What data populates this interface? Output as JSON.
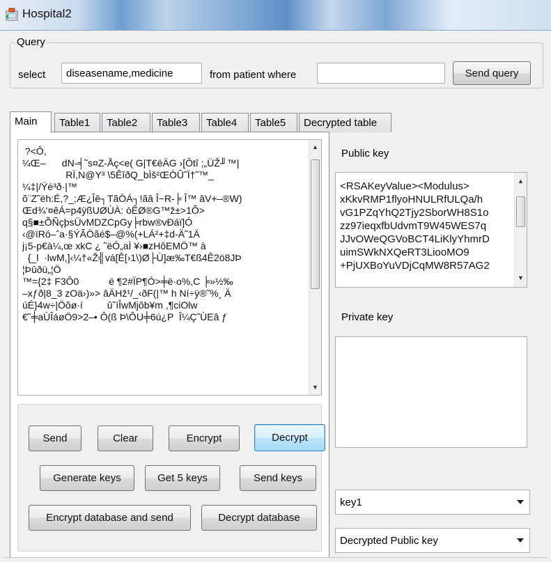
{
  "window": {
    "title": "Hospital2"
  },
  "query": {
    "group_label": "Query",
    "select_label": "select",
    "select_value": "diseasename,medicine",
    "from_label": "from patient where",
    "where_value": "",
    "send_label": "Send query"
  },
  "tabs": [
    {
      "label": "Main",
      "active": true
    },
    {
      "label": "Table1"
    },
    {
      "label": "Table2"
    },
    {
      "label": "Table3"
    },
    {
      "label": "Table4"
    },
    {
      "label": "Table5"
    },
    {
      "label": "Decrypted table"
    }
  ],
  "main": {
    "cipher_text": " ?<Ô,\n¼Œ–      dN-╡˜s¤Z-Åç<e( G|T€ëÄG ›[Ôtî ;„ÜŽ╜™|\n                RÏ,N@Y³ \\5ÊîðQ_bÌš²ŒÒÛ˜Ï†˜™_\n¼‡|/Ýé³ð·|™\nõ¨Z˜ëh:É,?_;Æ¿Îê┐TãÓÁ┐!ãâ Î−R-╞ Î™ âV+–®W)\nŒd¾‘¤êÁ=p4ÿßUØÙÀ: òÊØ®G™ž±>1Õ>\nq§■±ÕÑçþsÜvMDZCpGy╞rbw®vÐáï]Ó\n‹@ïRó–ˆa·§ÝÃÖãé$–@%(+LÁ²+‡d-Ä˜1Ä\nj¡5-p€à¼,œ xkC ¿ ˜ëÓ„aÌ ¥›■zHôEMÖ™ à\n  {_l  ·lwM,]‹¼†«Ž╣và[Ê[›1\\)Ø├Ù]æ‰T€ß4Ê2ö8JÞ\n¦Þûðü„¦Ö\n™={2‡ F3Ô0           ë ¶2#ÏP¶Ó>╪ë·o%,C ╞»½‰\n–xƒð|8_3 zOä›)»> âÄHž¹/_‹ðF(|™ h Ní÷ÿ®˜%¸ Ä\núÉ}4w÷|Öõø·í         û˜íÎwMjôb¥m ,¶ciOlw\n€˜╪aÙÎáøÖ9>2–• Ô(ß Þ\\ÔU╪6ú¿P  Î¼Ç˜ÙEâ ƒ",
    "buttons": {
      "send": "Send",
      "clear": "Clear",
      "encrypt": "Encrypt",
      "decrypt": "Decrypt",
      "generate_keys": "Generate keys",
      "get_5_keys": "Get 5 keys",
      "send_keys": "Send keys",
      "encrypt_db": "Encrypt database and send",
      "decrypt_db": "Decrypt database"
    }
  },
  "keys": {
    "public_label": "Public key",
    "public_text": "<RSAKeyValue><Modulus>\nxKkvRMP1flyoHNULRfULQa/h\nvG1PZqYhQ2Tjy2SborWH8S1o\nzz97ieqxfbUdvmT9W45WES7q\nJJvOWeQGVoBCT4LiKlyYhmrD\nuimSWkNXQeRT3LiooMO9\n+PjUXBoYuVDjCqMW8R57AG2",
    "private_label": "Private key",
    "private_text": "",
    "key_select": "key1",
    "type_select": "Decrypted Public key"
  }
}
